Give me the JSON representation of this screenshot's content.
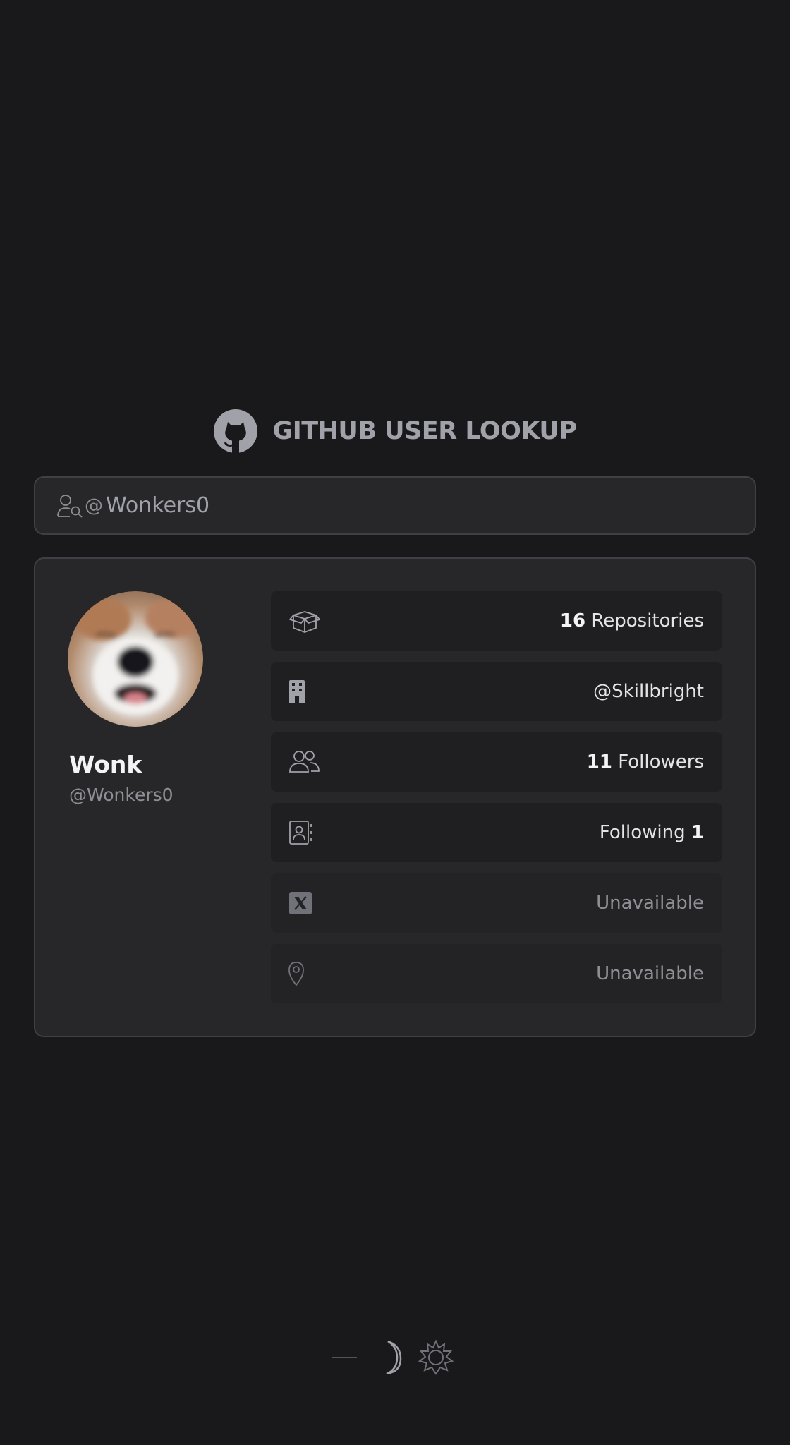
{
  "app": {
    "title": "GITHUB USER LOOKUP",
    "logo_icon": "github-icon"
  },
  "search": {
    "icon": "user-search-icon",
    "at_sign": "@",
    "value": "Wonkers0",
    "placeholder": "Wonkers0"
  },
  "profile": {
    "avatar_alt": "Wonk",
    "name": "Wonk",
    "login": "@Wonkers0"
  },
  "stats": {
    "repositories": {
      "icon": "box-icon",
      "count": "16",
      "label": "Repositories"
    },
    "company": {
      "icon": "building-icon",
      "value": "@Skillbright"
    },
    "followers": {
      "icon": "users-icon",
      "count": "11",
      "label": "Followers"
    },
    "following": {
      "icon": "contact-book-icon",
      "label": "Following",
      "count": "1"
    },
    "twitter": {
      "icon": "x-twitter-icon",
      "value": "Unavailable"
    },
    "location": {
      "icon": "map-pin-icon",
      "value": "Unavailable"
    }
  },
  "theme_switch": {
    "icons": [
      "moon-icon",
      "sun-icon"
    ],
    "active": "dark"
  },
  "colors": {
    "background": "#19191b",
    "card": "#27272a",
    "border": "#3f3f46",
    "row": "#1f1f22",
    "muted_text": "#8e8e95",
    "title_text": "#a1a1aa"
  }
}
